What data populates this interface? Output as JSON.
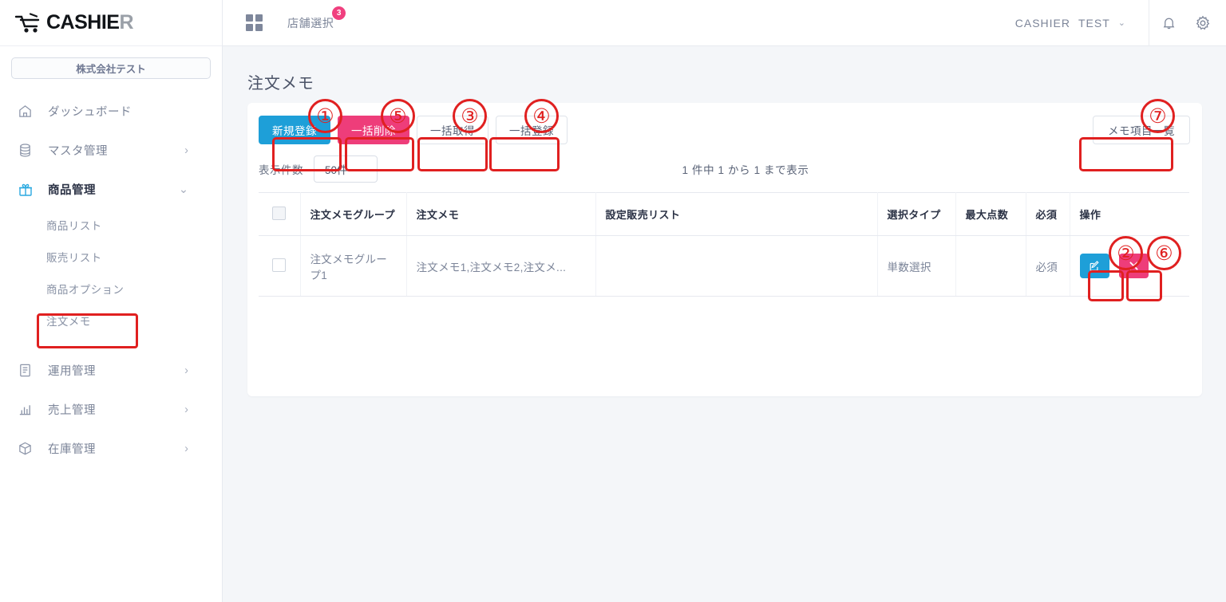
{
  "brand": {
    "name_main": "CASHIE",
    "name_accent": "R",
    "cart_icon": "shopping-cart-icon"
  },
  "sidebar": {
    "company": "株式会社テスト",
    "items": [
      {
        "label": "ダッシュボード",
        "icon": "home-icon",
        "chevron": "",
        "active": false
      },
      {
        "label": "マスタ管理",
        "icon": "database-icon",
        "chevron": "›",
        "active": false
      },
      {
        "label": "商品管理",
        "icon": "gift-icon",
        "chevron": "⌄",
        "active": true
      },
      {
        "label": "運用管理",
        "icon": "document-icon",
        "chevron": "›",
        "active": false
      },
      {
        "label": "売上管理",
        "icon": "bar-chart-icon",
        "chevron": "›",
        "active": false
      },
      {
        "label": "在庫管理",
        "icon": "box-icon",
        "chevron": "›",
        "active": false
      }
    ],
    "subitems": [
      {
        "label": "商品リスト"
      },
      {
        "label": "販売リスト"
      },
      {
        "label": "商品オプション"
      },
      {
        "label": "注文メモ"
      }
    ]
  },
  "header": {
    "grid_icon": "grid-icon",
    "store_select": "店舗選択",
    "store_badge": "3",
    "user_role": "CASHIER",
    "user_name": "TEST",
    "user_caret": "⌄",
    "bell_icon": "bell-icon",
    "gear_icon": "gear-icon"
  },
  "main": {
    "page_title": "注文メモ",
    "toolbar": {
      "new_register": "新規登録",
      "bulk_delete": "一括削除",
      "bulk_fetch": "一括取得",
      "bulk_register": "一括登録",
      "memo_items": "メモ項目一覧"
    },
    "perpage": {
      "label": "表示件数",
      "value": "50件",
      "caret": "⌄",
      "range_text": "1 件中 1 から 1 まで表示"
    },
    "table": {
      "columns": [
        "",
        "注文メモグループ",
        "注文メモ",
        "設定販売リスト",
        "選択タイプ",
        "最大点数",
        "必須",
        "操作"
      ],
      "rows": [
        {
          "memo_group": "注文メモグループ1",
          "memo": "注文メモ1,注文メモ2,注文メ...",
          "sales_list": "",
          "select_type": "単数選択",
          "max_points": "",
          "required": "必須",
          "edit_icon": "edit-pencil-icon",
          "delete_icon": "close-x-icon"
        }
      ]
    }
  },
  "annotations": [
    {
      "number": "①"
    },
    {
      "number": "②"
    },
    {
      "number": "③"
    },
    {
      "number": "④"
    },
    {
      "number": "⑤"
    },
    {
      "number": "⑥"
    },
    {
      "number": "⑦"
    }
  ],
  "colors": {
    "primary_blue": "#1e9fd8",
    "danger_pink": "#ee3d7a",
    "annotation_red": "#e02020",
    "page_bg": "#f4f6f9"
  }
}
